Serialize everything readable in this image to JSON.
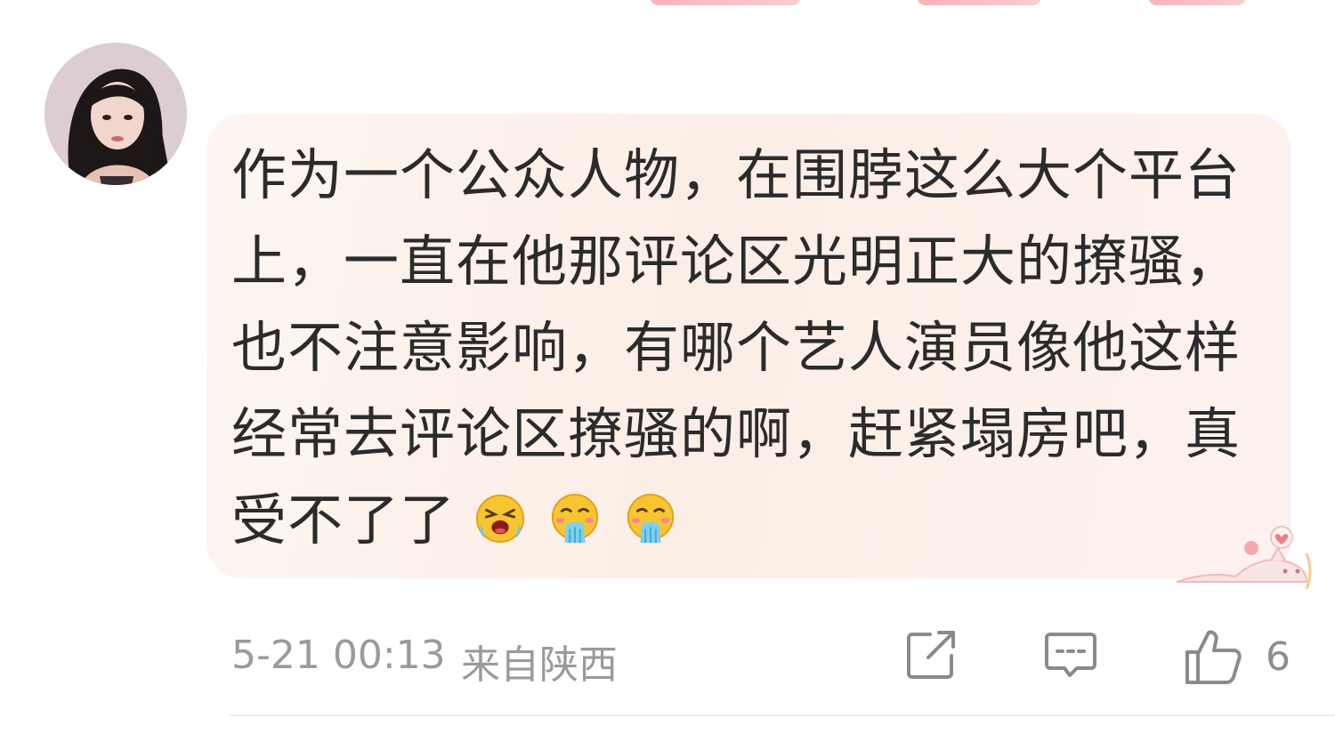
{
  "comment": {
    "text": "作为一个公众人物，在围脖这么大个平台上，一直在他那评论区光明正大的撩骚，也不注意影响，有哪个艺人演员像他这样经常去评论区撩骚的啊，赶紧塌房吧，真受不了了",
    "emojis": [
      "crying-face-emoji",
      "vomit-face-emoji",
      "vomit-face-emoji"
    ]
  },
  "footer": {
    "timestamp": "5-21 00:13",
    "location": "来自陕西",
    "like_count": "6"
  },
  "icons": {
    "share": "share-icon",
    "comment": "comment-icon",
    "like": "thumbs-up-icon"
  },
  "colors": {
    "bubble_bg": "#fbeee6",
    "meta_text": "#9a9a9a",
    "body_text": "#2b2b2b"
  }
}
